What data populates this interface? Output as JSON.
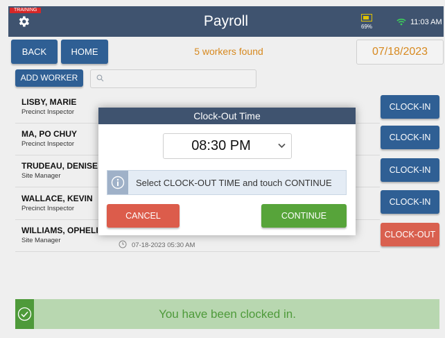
{
  "header": {
    "training_badge": "TRAINING",
    "title": "Payroll",
    "battery_pct": "69%",
    "time": "11:03 AM"
  },
  "toolbar": {
    "back_label": "BACK",
    "home_label": "HOME",
    "workers_found": "5 workers found",
    "date": "07/18/2023",
    "add_worker_label": "ADD WORKER",
    "search_placeholder": ""
  },
  "workers": [
    {
      "name": "LISBY, MARIE",
      "role": "Precinct Inspector",
      "action": "CLOCK-IN"
    },
    {
      "name": "MA, PO CHUY",
      "role": "Precinct Inspector",
      "action": "CLOCK-IN"
    },
    {
      "name": "TRUDEAU, DENISE",
      "role": "Site Manager",
      "action": "CLOCK-IN"
    },
    {
      "name": "WALLACE, KEVIN",
      "role": "Precinct Inspector",
      "action": "CLOCK-IN"
    },
    {
      "name": "WILLIAMS, OPHELIA",
      "role": "Site Manager",
      "clock_time": "07-18-2023 05:30 AM",
      "action": "CLOCK-OUT"
    }
  ],
  "modal": {
    "title": "Clock-Out Time",
    "selected_time": "08:30 PM",
    "info_text": "Select CLOCK-OUT TIME and touch CONTINUE",
    "cancel_label": "CANCEL",
    "continue_label": "CONTINUE"
  },
  "toast": {
    "message": "You have been clocked in."
  },
  "colors": {
    "topbar": "#3f536f",
    "primary": "#2f5f94",
    "accent_orange": "#d7891f",
    "danger": "#dc5c4b",
    "success": "#57a43a"
  },
  "icons": [
    "gear-icon",
    "battery-icon",
    "wifi-icon",
    "search-icon",
    "clock-icon",
    "chevron-down-icon",
    "info-icon",
    "check-circle-icon"
  ]
}
